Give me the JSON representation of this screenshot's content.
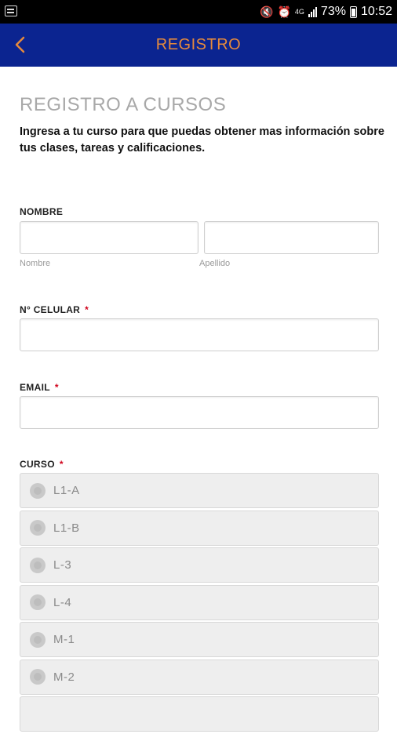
{
  "status_bar": {
    "battery_percent": "73%",
    "time": "10:52",
    "network": "4G"
  },
  "app_bar": {
    "title": "REGISTRO"
  },
  "form": {
    "title": "REGISTRO A CURSOS",
    "intro": "Ingresa a tu curso para que puedas obtener mas información sobre tus clases, tareas y calificaciones.",
    "name_label": "NOMBRE",
    "first_name_hint": "Nombre",
    "last_name_hint": "Apellido",
    "phone_label": "N° CELULAR",
    "email_label": "EMAIL",
    "course_label": "CURSO",
    "required_mark": "*",
    "courses": [
      "L1-A",
      "L1-B",
      "L-3",
      "L-4",
      "M-1",
      "M-2"
    ]
  },
  "colors": {
    "app_bar": "#0b2490",
    "accent": "#e58a3c",
    "required": "#d0021b"
  }
}
